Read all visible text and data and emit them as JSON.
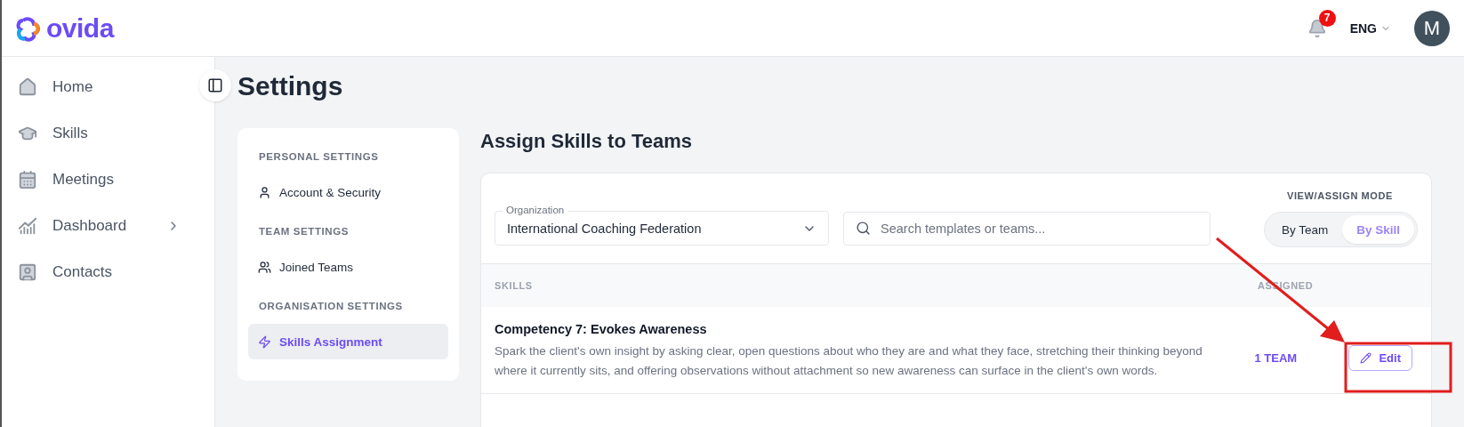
{
  "header": {
    "logo": "ovida",
    "notifications": {
      "count": "7"
    },
    "language": "ENG",
    "avatar": "M"
  },
  "sidebar": {
    "items": [
      {
        "label": "Home",
        "has_submenu": false
      },
      {
        "label": "Skills",
        "has_submenu": false
      },
      {
        "label": "Meetings",
        "has_submenu": false
      },
      {
        "label": "Dashboard",
        "has_submenu": true
      },
      {
        "label": "Contacts",
        "has_submenu": false
      }
    ]
  },
  "page": {
    "title": "Settings"
  },
  "settings_nav": {
    "sections": [
      {
        "heading": "PERSONAL SETTINGS",
        "items": [
          {
            "label": "Account & Security",
            "selected": false
          }
        ]
      },
      {
        "heading": "TEAM SETTINGS",
        "items": [
          {
            "label": "Joined Teams",
            "selected": false
          }
        ]
      },
      {
        "heading": "ORGANISATION SETTINGS",
        "items": [
          {
            "label": "Skills Assignment",
            "selected": true
          }
        ]
      }
    ]
  },
  "assign": {
    "title": "Assign Skills to Teams",
    "organization": {
      "label": "Organization",
      "value": "International Coaching Federation"
    },
    "search": {
      "placeholder": "Search templates or teams..."
    },
    "mode": {
      "label": "VIEW/ASSIGN MODE",
      "options": [
        {
          "label": "By Team",
          "selected": false
        },
        {
          "label": "By Skill",
          "selected": true
        }
      ]
    },
    "table": {
      "columns": [
        "SKILLS",
        "ASSIGNED"
      ],
      "rows": [
        {
          "title": "Competency 7: Evokes Awareness",
          "description": "Spark the client's own insight by asking clear, open questions about who they are and what they face, stretching their thinking beyond where it currently sits, and offering observations without attachment so new awareness can surface in the client's own words.",
          "assigned": "1 TEAM",
          "action": "Edit"
        }
      ]
    }
  }
}
